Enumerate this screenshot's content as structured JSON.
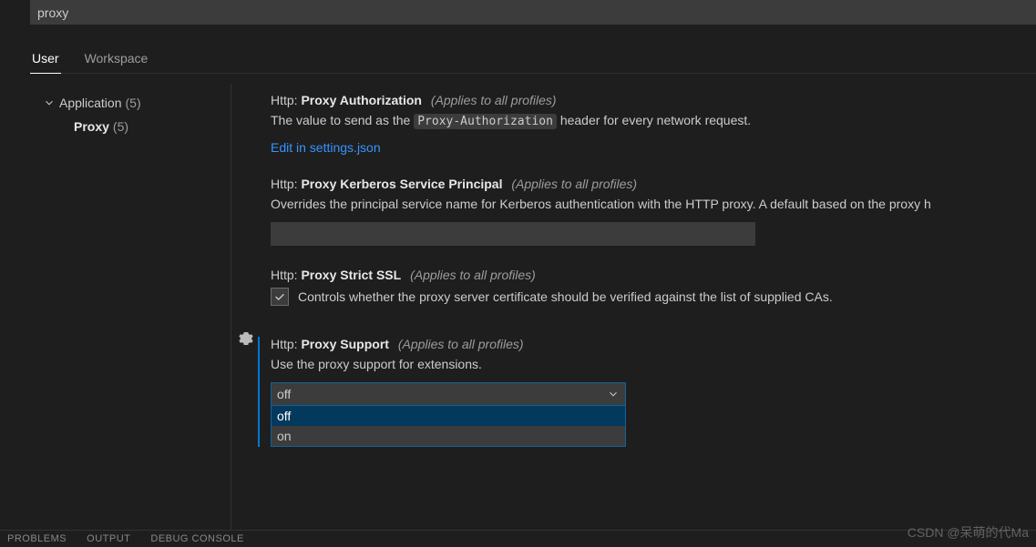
{
  "search": {
    "value": "proxy"
  },
  "tabs": {
    "user": "User",
    "workspace": "Workspace"
  },
  "tree": {
    "group": "Application",
    "group_count": "(5)",
    "item": "Proxy",
    "item_count": "(5)"
  },
  "settings": {
    "auth": {
      "cat": "Http:",
      "name": "Proxy Authorization",
      "scope": "(Applies to all profiles)",
      "desc_pre": "The value to send as the ",
      "code": "Proxy-Authorization",
      "desc_post": " header for every network request.",
      "link": "Edit in settings.json"
    },
    "kerb": {
      "cat": "Http:",
      "name": "Proxy Kerberos Service Principal",
      "scope": "(Applies to all profiles)",
      "desc": "Overrides the principal service name for Kerberos authentication with the HTTP proxy. A default based on the proxy h",
      "value": ""
    },
    "ssl": {
      "cat": "Http:",
      "name": "Proxy Strict SSL",
      "scope": "(Applies to all profiles)",
      "desc": "Controls whether the proxy server certificate should be verified against the list of supplied CAs."
    },
    "support": {
      "cat": "Http:",
      "name": "Proxy Support",
      "scope": "(Applies to all profiles)",
      "desc": "Use the proxy support for extensions.",
      "value": "off",
      "options": [
        "off",
        "on"
      ]
    }
  },
  "panel": {
    "problems": "Problems",
    "output": "Output",
    "debug": "Debug Console"
  },
  "watermark": "CSDN @呆萌的代Ma"
}
